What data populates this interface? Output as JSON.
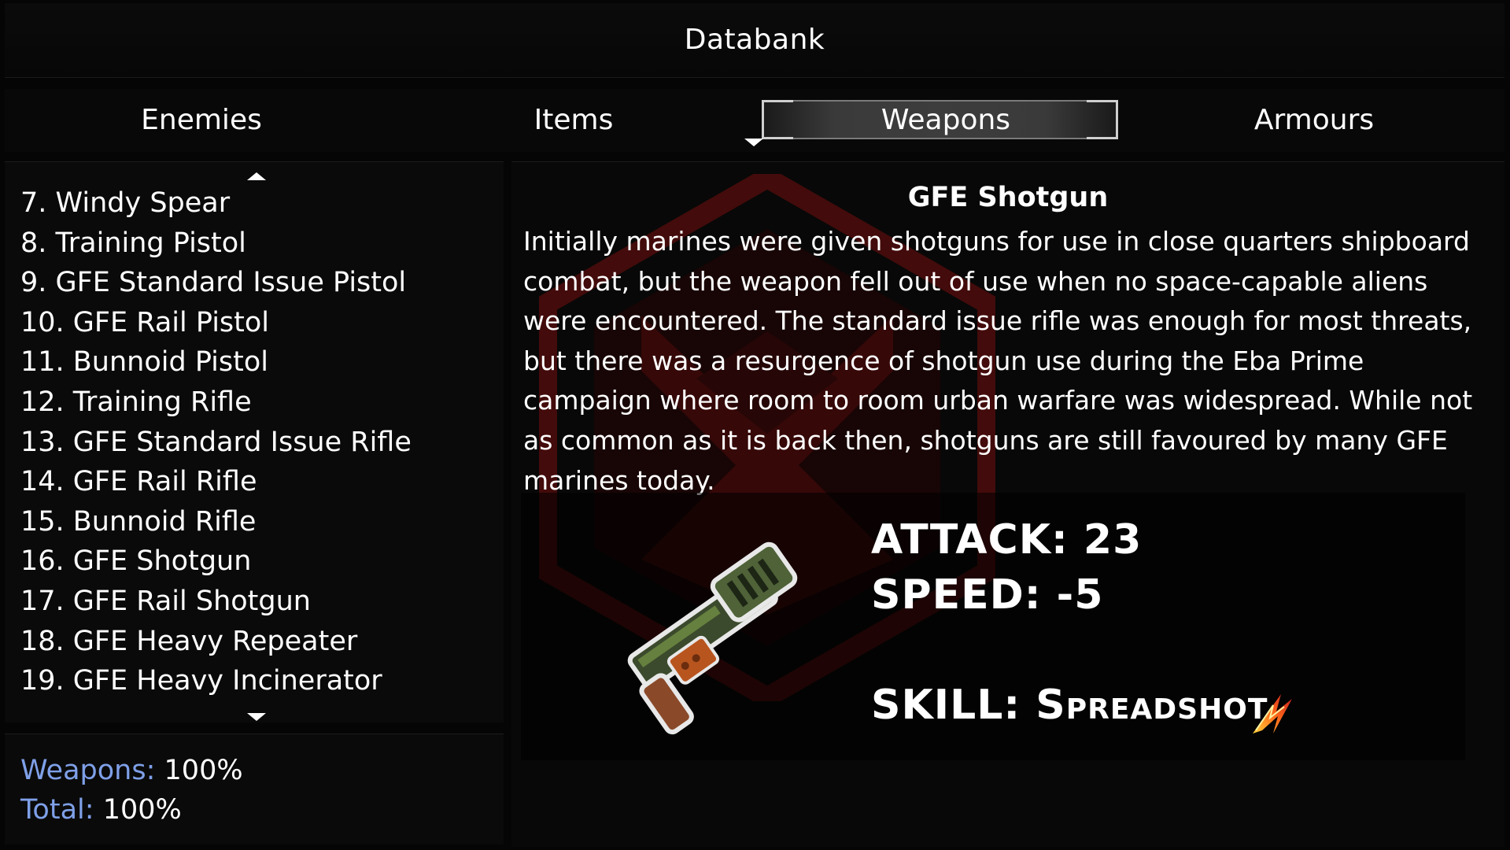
{
  "header": {
    "title": "Databank"
  },
  "tabs": [
    {
      "label": "Enemies",
      "active": false
    },
    {
      "label": "Items",
      "active": false
    },
    {
      "label": "Weapons",
      "active": true
    },
    {
      "label": "Armours",
      "active": false
    }
  ],
  "weapon_list": {
    "items": [
      "7. Windy Spear",
      "8. Training Pistol",
      "9. GFE Standard Issue Pistol",
      "10. GFE Rail Pistol",
      "11. Bunnoid Pistol",
      "12. Training Rifle",
      "13. GFE Standard Issue Rifle",
      "14. GFE Rail Rifle",
      "15. Bunnoid Rifle",
      "16. GFE Shotgun",
      "17. GFE Rail Shotgun",
      "18. GFE Heavy Repeater",
      "19. GFE Heavy Incinerator"
    ],
    "selected": "16. GFE Shotgun"
  },
  "completion": {
    "weapons_label": "Weapons:",
    "weapons_value": "100%",
    "total_label": "Total:",
    "total_value": "100%"
  },
  "detail": {
    "name": "GFE Shotgun",
    "description_lines": [
      "Initially marines were given shotguns for use in close quarters shipboard",
      "combat, but the weapon fell out of use when no space-capable aliens",
      "were encountered. The standard issue rifle was enough for most threats,",
      "but there was a resurgence of shotgun use during the Eba Prime",
      "campaign where room to room urban warfare was widespread. While not",
      "as common as it is back then, shotguns are still favoured by many GFE",
      "marines today."
    ],
    "attack": "ATTACK: 23",
    "speed": "SPEED: -5",
    "skill_label": "SKILL:",
    "skill_value": "Spreadshot",
    "weapon_icon": "shotgun-icon",
    "skill_icon": "spreadshot-icon"
  },
  "colors": {
    "accent_label": "#7fa0e8",
    "emblem_red": "#5a0e0e"
  }
}
